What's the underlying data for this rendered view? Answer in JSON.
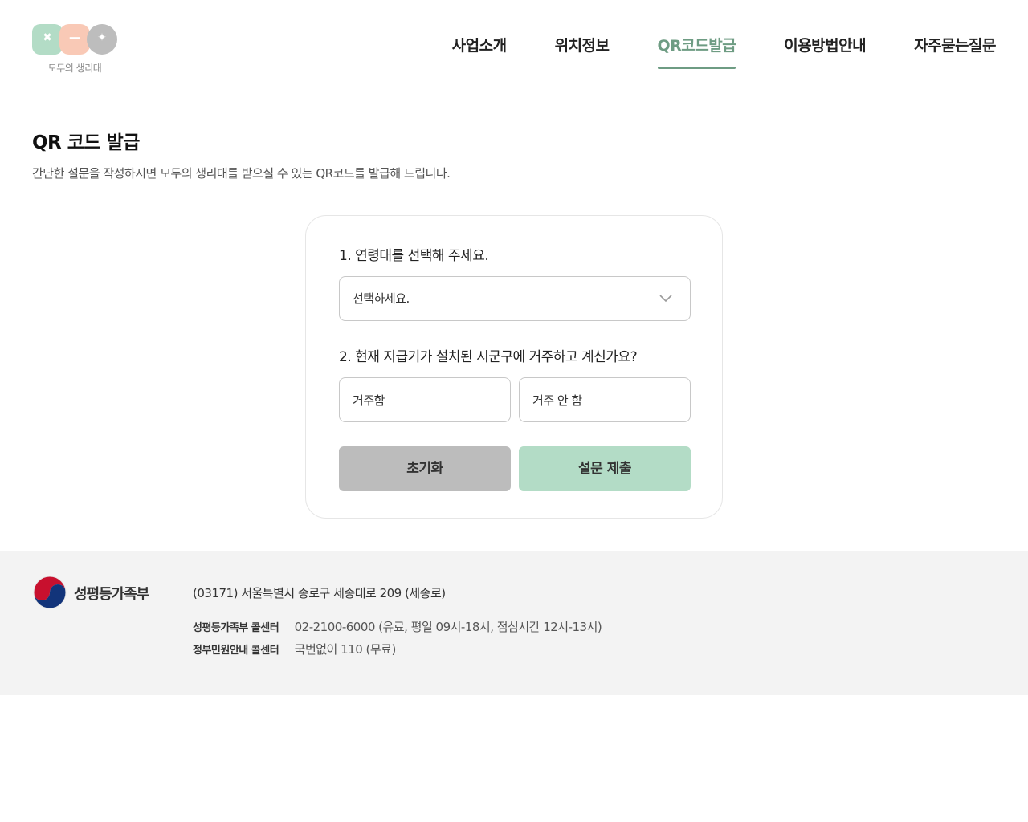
{
  "header": {
    "logo_text": "모두의 생리대",
    "logo_symbols": [
      "✖",
      "—",
      "✦"
    ],
    "nav": [
      {
        "label": "사업소개",
        "active": false
      },
      {
        "label": "위치정보",
        "active": false
      },
      {
        "label": "QR코드발급",
        "active": true
      },
      {
        "label": "이용방법안내",
        "active": false
      },
      {
        "label": "자주묻는질문",
        "active": false
      }
    ]
  },
  "page": {
    "title": "QR 코드 발급",
    "description": "간단한 설문을 작성하시면 모두의 생리대를 받으실 수 있는 QR코드를 발급해 드립니다."
  },
  "survey": {
    "q1_label": "1. 연령대를 선택해 주세요.",
    "q1_select_value": "선택하세요.",
    "q2_label": "2. 현재 지급기가 설치된 시군구에 거주하고 계신가요?",
    "q2_options": [
      "거주함",
      "거주 안 함"
    ],
    "reset_label": "초기화",
    "submit_label": "설문 제출"
  },
  "footer": {
    "gov_name": "성평등가족부",
    "address": "(03171) 서울특별시 종로구 세종대로 209 (세종로)",
    "contacts": [
      {
        "label": "성평등가족부 콜센터",
        "value": "02-2100-6000 (유료, 평일 09시-18시, 점심시간 12시-13시)"
      },
      {
        "label": "정부민원안내 콜센터",
        "value": "국번없이 110 (무료)"
      }
    ]
  },
  "colors": {
    "accent": "#6e9c83",
    "submit_bg": "#b3dcc6",
    "reset_bg": "#bcbcbc",
    "footer_bg": "#f3f3f3"
  },
  "icons": {
    "select": "chevron-down-icon",
    "gov": "taegeuk-icon"
  }
}
